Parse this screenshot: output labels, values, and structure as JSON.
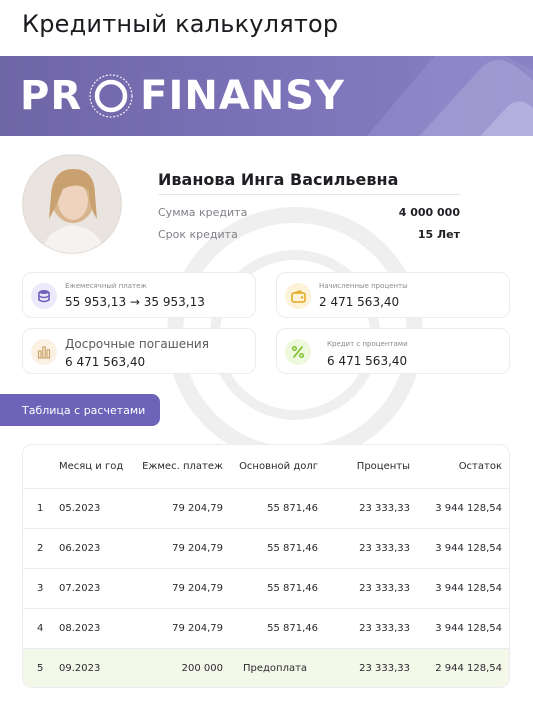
{
  "page": {
    "title": "Кредитный калькулятор"
  },
  "banner": {
    "logo_left": "PR",
    "logo_right": "FINANSY"
  },
  "profile": {
    "name": "Иванова Инга Васильевна",
    "loan_amount_label": "Сумма кредита",
    "loan_amount_value": "4 000 000",
    "loan_term_label": "Срок кредита",
    "loan_term_value": "15  Лет"
  },
  "cards": [
    {
      "label": "Ежемесячный платеж",
      "value_from": "55 953,13",
      "arrow": "→",
      "value_to": "35 953,13",
      "icon": "coins-stack-icon",
      "icon_color": "#6d63b8",
      "icon_bg": "#ece9fb"
    },
    {
      "label": "Начисленные проценты",
      "value": "2 471 563,40",
      "icon": "wallet-icon",
      "icon_color": "#e0a81c",
      "icon_bg": "#fdf3d8"
    },
    {
      "label": "Досрочные погашения",
      "value": "6 471 563,40",
      "icon": "bar-chart-icon",
      "icon_color": "#c9a46a",
      "icon_bg": "#fbf2e3"
    },
    {
      "label": "Кредит с процентами",
      "value": "6 471 563,40",
      "icon": "percent-icon",
      "icon_color": "#7fbf2a",
      "icon_bg": "#eef8dc"
    }
  ],
  "tab": {
    "label": "Таблица с расчетами"
  },
  "table": {
    "headers": [
      "",
      "Месяц и год",
      "Ежмес. платеж",
      "Основной долг",
      "Проценты",
      "Остаток"
    ],
    "rows": [
      [
        "1",
        "05.2023",
        "79 204,79",
        "55 871,46",
        "23 333,33",
        "3 944 128,54"
      ],
      [
        "2",
        "06.2023",
        "79 204,79",
        "55 871,46",
        "23 333,33",
        "3 944 128,54"
      ],
      [
        "3",
        "07.2023",
        "79 204,79",
        "55 871,46",
        "23 333,33",
        "3 944 128,54"
      ],
      [
        "4",
        "08.2023",
        "79 204,79",
        "55 871,46",
        "23 333,33",
        "3 944 128,54"
      ],
      [
        "5",
        "09.2023",
        "200 000",
        "Предоплата",
        "23 333,33",
        "2 944 128,54"
      ]
    ]
  },
  "colors": {
    "accent": "#6d63b8",
    "highlight_row": "#f4f8e8"
  }
}
